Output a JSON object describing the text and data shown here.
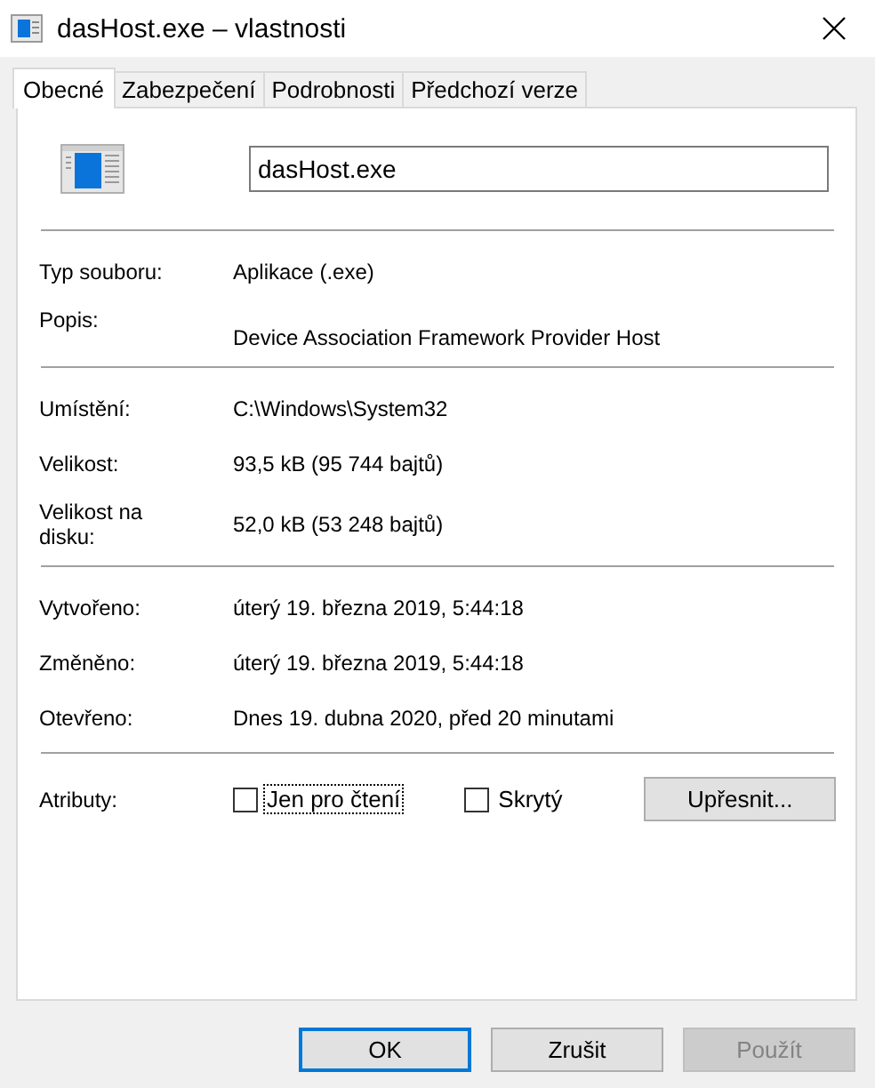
{
  "window": {
    "title": "dasHost.exe – vlastnosti"
  },
  "tabs": [
    {
      "label": "Obecné",
      "selected": true
    },
    {
      "label": "Zabezpečení",
      "selected": false
    },
    {
      "label": "Podrobnosti",
      "selected": false
    },
    {
      "label": "Předchozí verze",
      "selected": false
    }
  ],
  "file_name": {
    "value": "dasHost.exe"
  },
  "sections": [
    {
      "rows": [
        {
          "kind": "text",
          "label": "Typ souboru:",
          "value": "Aplikace (.exe)"
        },
        {
          "kind": "description",
          "label": "Popis:",
          "value": "Device Association Framework Provider Host"
        }
      ]
    },
    {
      "rows": [
        {
          "kind": "text",
          "label": "Umístění:",
          "value": "C:\\Windows\\System32"
        },
        {
          "kind": "text",
          "label": "Velikost:",
          "value": "93,5 kB (95 744 bajtů)"
        },
        {
          "kind": "text",
          "label": "Velikost na disku:",
          "value": "52,0 kB (53 248 bajtů)"
        }
      ]
    },
    {
      "rows": [
        {
          "kind": "text",
          "label": "Vytvořeno:",
          "value": "úterý 19. března 2019, 5:44:18"
        },
        {
          "kind": "text",
          "label": "Změněno:",
          "value": "úterý 19. března 2019, 5:44:18"
        },
        {
          "kind": "text",
          "label": "Otevřeno:",
          "value": "Dnes 19. dubna 2020, před 20 minutami"
        }
      ]
    }
  ],
  "attributes": {
    "label": "Atributy:",
    "checkboxes": [
      {
        "label": "Jen pro čtení",
        "checked": false,
        "focused": true
      },
      {
        "label": "Skrytý",
        "checked": false,
        "focused": false
      }
    ],
    "advanced_button": "Upřesnit..."
  },
  "buttons": [
    {
      "label": "OK",
      "kind": "default",
      "disabled": false
    },
    {
      "label": "Zrušit",
      "kind": "normal",
      "disabled": false
    },
    {
      "label": "Použít",
      "kind": "normal",
      "disabled": true
    }
  ]
}
